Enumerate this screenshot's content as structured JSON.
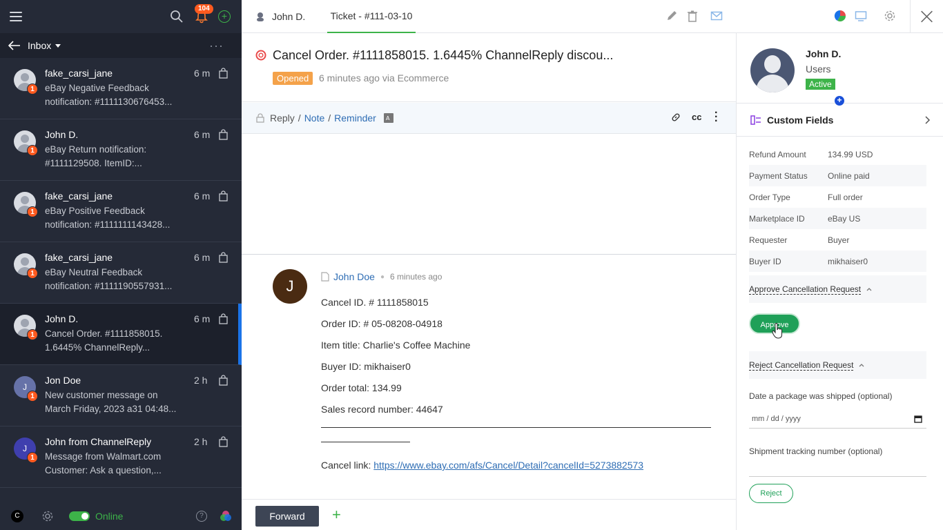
{
  "sidebar": {
    "notif_count": "104",
    "inbox_label": "Inbox",
    "conversations": [
      {
        "name": "fake_carsi_jane",
        "snippet": "eBay Negative Feedback notification: #1111130676453...",
        "time": "6 m",
        "count": "1",
        "avatar": "",
        "active": false
      },
      {
        "name": "John D.",
        "snippet": "eBay Return notification: #1111129508. ItemID:...",
        "time": "6 m",
        "count": "1",
        "avatar": "",
        "active": false
      },
      {
        "name": "fake_carsi_jane",
        "snippet": "eBay Positive Feedback notification: #1111111143428...",
        "time": "6 m",
        "count": "1",
        "avatar": "",
        "active": false
      },
      {
        "name": "fake_carsi_jane",
        "snippet": "eBay Neutral Feedback notification: #1111190557931...",
        "time": "6 m",
        "count": "1",
        "avatar": "",
        "active": false
      },
      {
        "name": "John D.",
        "snippet": "Cancel Order. #1111858015. 1.6445% ChannelReply...",
        "time": "6 m",
        "count": "1",
        "avatar": "",
        "active": true
      },
      {
        "name": "Jon Doe",
        "snippet": "New customer message on March Friday, 2023 a31 04:48...",
        "time": "2 h",
        "count": "1",
        "avatar": "J",
        "active": false
      },
      {
        "name": "John from ChannelReply",
        "snippet": "Message from Walmart.com Customer: Ask a question,...",
        "time": "2 h",
        "count": "1",
        "avatar": "J",
        "active": false
      }
    ],
    "footer": {
      "user_initial": "C",
      "status_label": "Online"
    }
  },
  "topbar": {
    "user_tab": "John D.",
    "ticket_tab": "Ticket - #111-03-10"
  },
  "ticket": {
    "title": "Cancel Order. #1111858015. 1.6445% ChannelReply discou...",
    "status": "Opened",
    "meta": "6 minutes ago via Ecommerce"
  },
  "reply_bar": {
    "reply": "Reply",
    "note": "Note",
    "reminder": "Reminder",
    "cc": "cc"
  },
  "message": {
    "avatar_letter": "J",
    "author": "John Doe",
    "ago": "6 minutes ago",
    "lines": [
      "Cancel ID. # 1111858015",
      "Order ID: # 05-08208-04918",
      "Item title: Charlie's Coffee Machine",
      "Buyer ID: mikhaiser0",
      "Order total: 134.99",
      "Sales record number: 44647"
    ],
    "cancel_prefix": "Cancel link: ",
    "cancel_link": "https://www.ebay.com/afs/Cancel/Detail?cancelId=5273882573"
  },
  "bottom": {
    "forward": "Forward"
  },
  "rpanel": {
    "user_name": "John D.",
    "user_role": "Users",
    "user_status": "Active",
    "custom_fields_label": "Custom Fields",
    "fields": [
      {
        "k": "Refund Amount",
        "v": "134.99 USD"
      },
      {
        "k": "Payment Status",
        "v": "Online paid"
      },
      {
        "k": "Order Type",
        "v": "Full order"
      },
      {
        "k": "Marketplace ID",
        "v": "eBay US"
      },
      {
        "k": "Requester",
        "v": "Buyer"
      },
      {
        "k": "Buyer ID",
        "v": "mikhaiser0"
      }
    ],
    "approve_section": "Approve Cancellation Request",
    "approve_button": "Approve",
    "reject_section": "Reject Cancellation Request",
    "date_label": "Date a package was shipped (optional)",
    "date_placeholder": "mm / dd / yyyy",
    "tracking_label": "Shipment tracking number (optional)",
    "reject_button": "Reject"
  },
  "colors": {
    "accent": "#3db349",
    "link": "#2e6db4",
    "badge": "#ff5a1f",
    "sidebar": "#252a37",
    "approve": "#1fa058",
    "opened": "#f4a24a"
  }
}
